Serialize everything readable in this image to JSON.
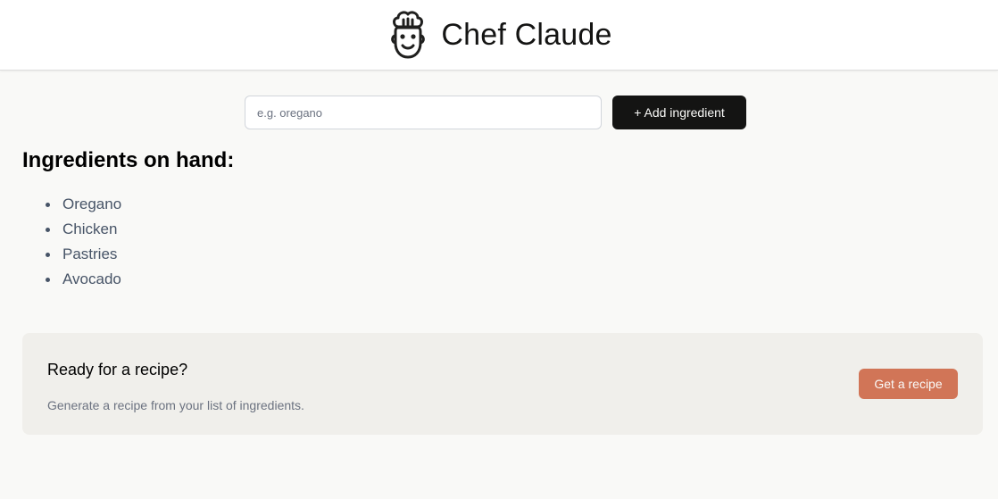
{
  "header": {
    "title": "Chef Claude",
    "logo_icon": "chef-face-icon"
  },
  "add_form": {
    "input_placeholder": "e.g. oregano",
    "input_value": "",
    "add_button_label": "+ Add ingredient"
  },
  "ingredients": {
    "heading": "Ingredients on hand:",
    "items": [
      "Oregano",
      "Chicken",
      "Pastries",
      "Avocado"
    ]
  },
  "recipe_prompt": {
    "title": "Ready for a recipe?",
    "subtitle": "Generate a recipe from your list of ingredients.",
    "button_label": "Get a recipe"
  },
  "colors": {
    "page_bg": "#f9f9f7",
    "header_bg": "#ffffff",
    "add_button_bg": "#141413",
    "recipe_panel_bg": "#f0efeb",
    "recipe_button_bg": "#d17557",
    "list_text": "#475467"
  }
}
